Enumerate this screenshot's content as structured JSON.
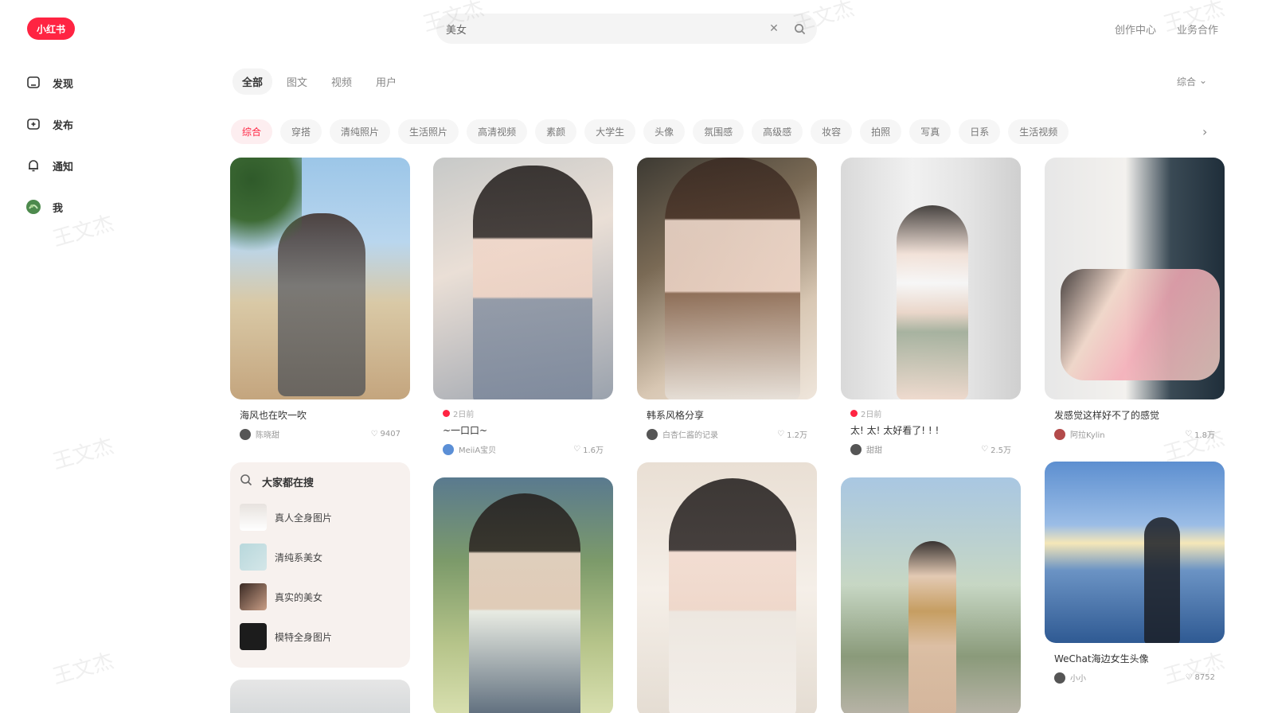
{
  "header": {
    "logo": "小红书",
    "search_value": "美女",
    "links": [
      "创作中心",
      "业务合作"
    ]
  },
  "sidebar": {
    "items": [
      {
        "label": "发现",
        "icon": "home-icon"
      },
      {
        "label": "发布",
        "icon": "publish-icon"
      },
      {
        "label": "通知",
        "icon": "bell-icon"
      },
      {
        "label": "我",
        "icon": "avatar-icon"
      }
    ]
  },
  "tabs": [
    "全部",
    "图文",
    "视频",
    "用户"
  ],
  "sort_label": "综合",
  "chips": [
    "综合",
    "穿搭",
    "清纯照片",
    "生活照片",
    "高清视频",
    "素颜",
    "大学生",
    "头像",
    "氛围感",
    "高级感",
    "妆容",
    "拍照",
    "写真",
    "日系",
    "生活视频"
  ],
  "notes": [
    {
      "title": "海风也在吹一吹",
      "author": "陈晓甜",
      "likes": "9407"
    },
    {
      "tag": "2日前",
      "title": "~一口口~",
      "author": "MeiiA宝贝",
      "likes": "1.6万"
    },
    {
      "title": "韩系风格分享",
      "author": "白杏仁酱的记录",
      "likes": "1.2万"
    },
    {
      "tag": "2日前",
      "title": "太! 太! 太好看了! ! !",
      "author": "甜甜",
      "likes": "2.5万"
    },
    {
      "title": "发感觉这样好不了的感觉",
      "author": "阿拉Kylin",
      "likes": "1.8万"
    },
    {
      "title": "WeChat海边女生头像",
      "author": "小小",
      "likes": "8752"
    }
  ],
  "suggest": {
    "title": "大家都在搜",
    "items": [
      "真人全身图片",
      "清纯系美女",
      "真实的美女",
      "模特全身图片"
    ]
  },
  "watermark": "王文杰"
}
